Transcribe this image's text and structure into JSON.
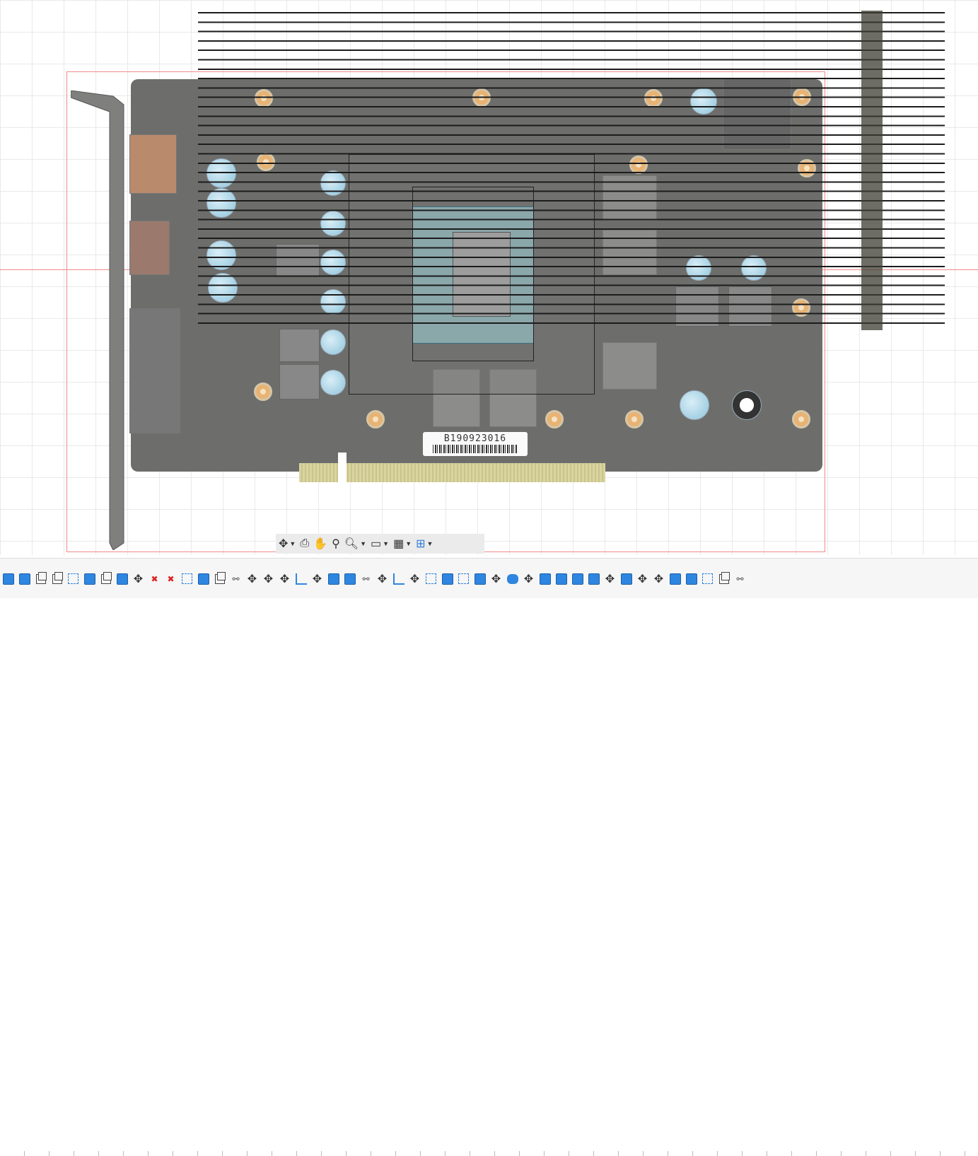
{
  "board": {
    "serial_label": "B190923016"
  },
  "canvas": {
    "grid": true,
    "background": "#ffffff",
    "grid_color": "#e9e9e9",
    "sketch_line_color": "#f08a8a"
  },
  "view_toolbar": {
    "items": [
      {
        "icon": "orbit-icon",
        "has_dropdown": true
      },
      {
        "icon": "look-at-icon",
        "has_dropdown": false
      },
      {
        "icon": "pan-hand-icon",
        "has_dropdown": false
      },
      {
        "icon": "zoom-icon",
        "has_dropdown": false
      },
      {
        "icon": "fit-zoom-icon",
        "has_dropdown": true
      },
      {
        "icon": "display-settings-icon",
        "has_dropdown": true
      },
      {
        "icon": "grid-settings-icon",
        "has_dropdown": true
      },
      {
        "icon": "viewports-icon",
        "has_dropdown": true
      }
    ]
  },
  "timeline": {
    "item_icons": [
      "body-icon",
      "body-icon",
      "component-icon",
      "component-icon",
      "sketch-icon",
      "body-icon",
      "component-icon",
      "body-icon",
      "move-icon",
      "delete-icon",
      "delete-icon",
      "sketch-icon",
      "body-icon",
      "component-icon",
      "joint-icon",
      "move-icon",
      "move-icon",
      "move-icon",
      "align-icon",
      "move-icon",
      "body-icon",
      "body-icon",
      "joint-icon",
      "move-icon",
      "align-icon",
      "move-icon",
      "sketch-icon",
      "body-icon",
      "sketch-icon",
      "body-icon",
      "move-icon",
      "cylinder-icon",
      "move-icon",
      "body-icon",
      "body-icon",
      "body-icon",
      "body-icon",
      "move-icon",
      "body-icon",
      "move-icon",
      "move-icon",
      "body-icon",
      "body-icon",
      "sketch-icon",
      "component-icon",
      "joint-icon"
    ]
  }
}
